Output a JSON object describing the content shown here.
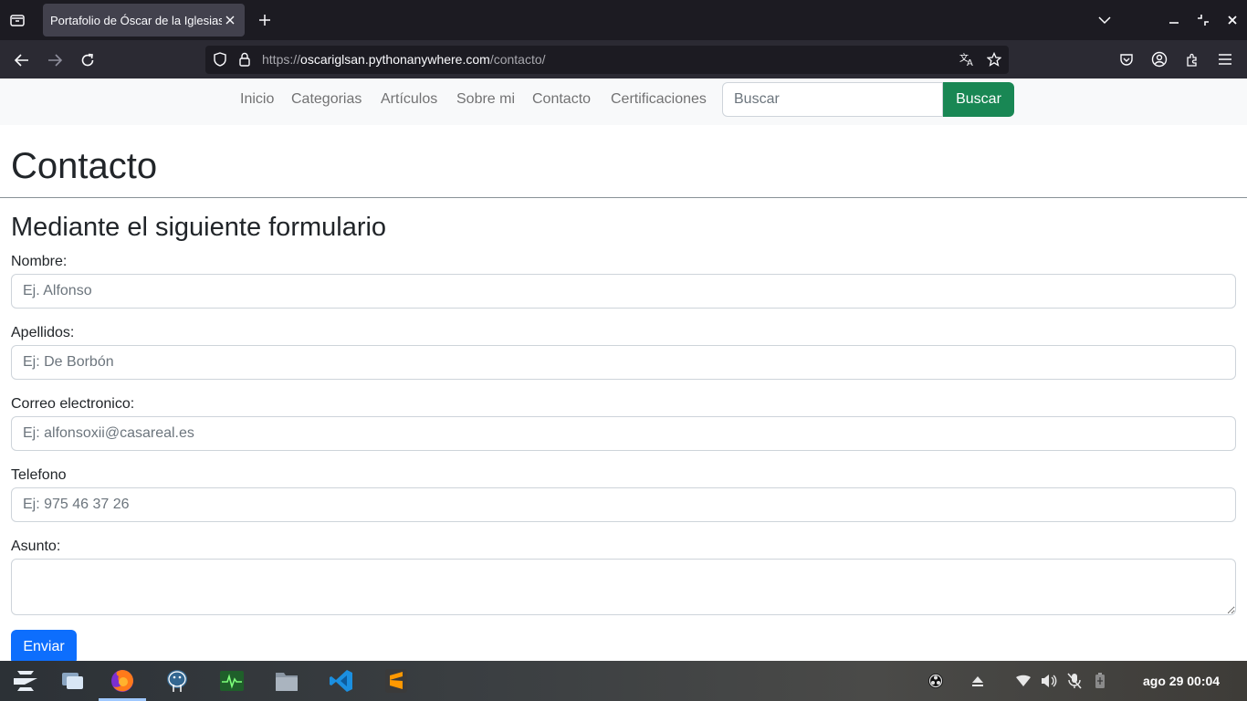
{
  "browser": {
    "tab_title": "Portafolio de Óscar de la Iglesias",
    "url_scheme": "https://",
    "url_host": "oscariglsan.pythonanywhere.com",
    "url_path": "/contacto/"
  },
  "site_nav": {
    "links": [
      "Inicio",
      "Categorias",
      "Artículos",
      "Sobre mi",
      "Contacto",
      "Certificaciones"
    ],
    "search_placeholder": "Buscar",
    "search_button": "Buscar"
  },
  "page": {
    "title": "Contacto",
    "subtitle": "Mediante el siguiente formulario"
  },
  "form": {
    "fields": [
      {
        "label": "Nombre:",
        "placeholder": "Ej. Alfonso"
      },
      {
        "label": "Apellidos:",
        "placeholder": "Ej: De Borbón"
      },
      {
        "label": "Correo electronico:",
        "placeholder": "Ej: alfonsoxii@casareal.es"
      },
      {
        "label": "Telefono",
        "placeholder": "Ej: 975 46 37 26"
      }
    ],
    "message_label": "Asunto:",
    "submit_label": "Enviar"
  },
  "taskbar": {
    "clock": "ago 29  00:04",
    "apps": [
      "zorin-menu-icon",
      "workspaces-icon",
      "firefox-icon",
      "pgadmin-icon",
      "system-monitor-icon",
      "files-icon",
      "vscode-icon",
      "sublime-text-icon"
    ]
  },
  "colors": {
    "primary": "#0d6efd",
    "success": "#198754",
    "browser_dark": "#1c1b22"
  }
}
